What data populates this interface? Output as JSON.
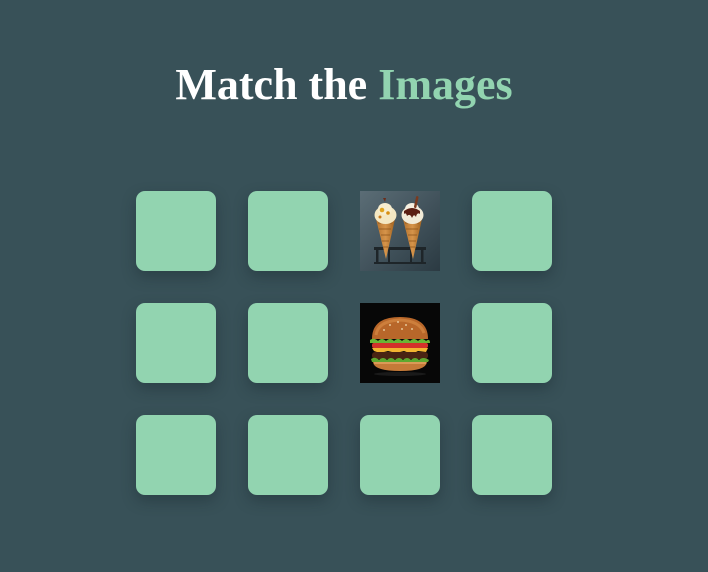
{
  "header": {
    "title_part1": "Match the",
    "title_part2": "Images"
  },
  "theme": {
    "background": "#385158",
    "card_color": "#92d4b0",
    "title_color": "#ffffff",
    "accent_color": "#92d4b0"
  },
  "board": {
    "rows": 3,
    "columns": 4,
    "cards": [
      {
        "row": 1,
        "col": 1,
        "state": "hidden"
      },
      {
        "row": 1,
        "col": 2,
        "state": "hidden"
      },
      {
        "row": 1,
        "col": 3,
        "state": "revealed",
        "image": "ice-cream-cones"
      },
      {
        "row": 1,
        "col": 4,
        "state": "hidden"
      },
      {
        "row": 2,
        "col": 1,
        "state": "hidden"
      },
      {
        "row": 2,
        "col": 2,
        "state": "hidden"
      },
      {
        "row": 2,
        "col": 3,
        "state": "revealed",
        "image": "burger"
      },
      {
        "row": 2,
        "col": 4,
        "state": "hidden"
      },
      {
        "row": 3,
        "col": 1,
        "state": "hidden"
      },
      {
        "row": 3,
        "col": 2,
        "state": "hidden"
      },
      {
        "row": 3,
        "col": 3,
        "state": "hidden"
      },
      {
        "row": 3,
        "col": 4,
        "state": "hidden"
      }
    ]
  }
}
